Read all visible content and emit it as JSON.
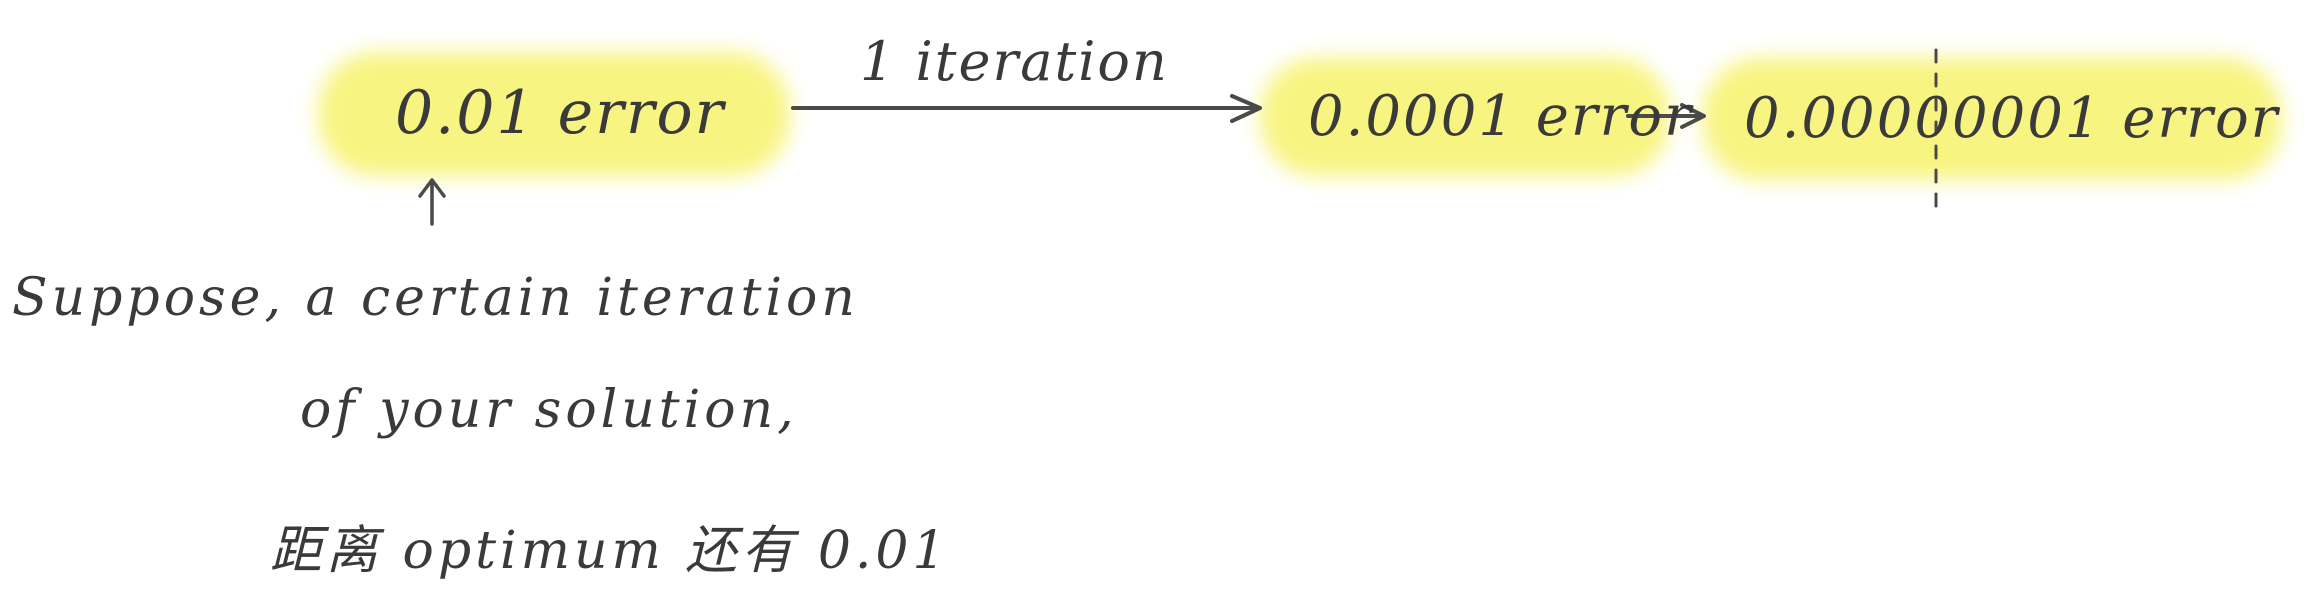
{
  "highlight_color": "#f6f26a",
  "ink_color": "#3a3a3a",
  "stages": [
    {
      "label": "0.01  error"
    },
    {
      "label": "0.0001 error"
    },
    {
      "label": "0.00000001  error"
    }
  ],
  "step_label": "1  iteration",
  "note": {
    "line1": "Suppose, a certain iteration",
    "line2": "of your solution,",
    "line3": "距离 optimum 还有 0.01"
  }
}
